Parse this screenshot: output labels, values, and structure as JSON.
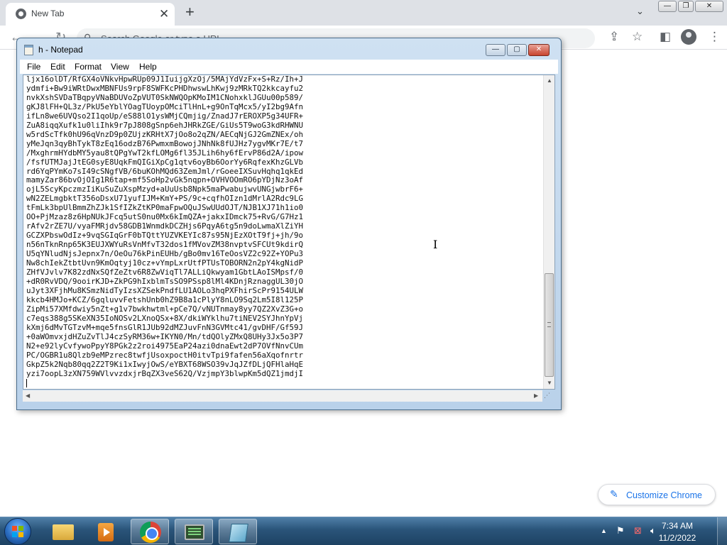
{
  "chrome": {
    "tab_title": "New Tab",
    "tab_close": "✕",
    "new_tab": "+",
    "tabs_dropdown": "⌄",
    "omnibox_placeholder": "Search Google or type a URL",
    "customize_label": "Customize Chrome",
    "window_controls": {
      "minimize": "—",
      "maximize": "❐",
      "close": "✕"
    }
  },
  "notepad": {
    "title": "h - Notepad",
    "window_controls": {
      "minimize": "—",
      "maximize": "▢",
      "close": "✕"
    },
    "menu": [
      "File",
      "Edit",
      "Format",
      "View",
      "Help"
    ],
    "lines": [
      "ljx16olDT/RfGX4oVNkvHpwRUp09J1IuijgXzOj/5MAjYdVzFx+S+Rz/Ih+J",
      "ydmfi+Bw9iWRtDwxMBNFUs9rpF8SWFKcPHDhwswLhKwj9zMRkTQ2kkcayfu2",
      "nvkXshSVDaTBqpyVNaBDUVoZpVUT0SkNWQOpKMoIM1CNohxklJGUu00p589/",
      "gKJ8lFH+QL3z/PkU5eYblYOagTUoypOMciTlHnL+g9OnTqMcx5/yI2bg9Afn",
      "ifLn8we6UVQso2I1qoUp/eS88lO1ysWMjCQmjig/ZnadJ7rEROXP5g34UFR+",
      "ZuA8iqqXufk1u0liIhk9r7pJ808gSnp6ehJHRkZGE/GiUs5T9woG3kdRHWNU",
      "w5rdScTfk0hU96qVnzD9p0ZUjzKRHtX7jOo8o2qZN/AECqNjGJ2GmZNEx/oh",
      "yMeJqn3qyBhTykT8zEq16odzB76PwmxmBowojJNhNk8fUJHz7ygvMKr7E/t7",
      "/MxghrmHYdbMY5yau8tQPgYwT2kfLOMg6fl35JLih6hy6fErvP86d2A/ipow",
      "/fsfUTMJajJtEG0syE8UqkFmQIGiXpCg1qtv6oyBb6OorYy6RqfexKhzGLVb",
      "rd6YqPYmKo7sI49cSNgfVB/6buKOhMQd63ZemJml/rGoeeIXSuvHqhq1qkEd",
      "mamyZar86bvOjOIg1R6tap+mf5SoHp2vGk5nqpn+OVHVOOmRO6pYDjNz3oAf",
      "ojL5ScyKpczmzIiKuSuZuXspMzyd+aUuUsb8Npk5maPwabujwvUNGjwbrF6+",
      "wN2ZELmgbktT356oDsxU71yufIJM+KmY+PS/9c+cqfhOIzn1dMrlA2Rdc9LG",
      "tFmLk3bpUlBmmZhZJk1SfIZkZtKP0maFpwOQuJSwUUdOJT/NJB1XJ71h1io0",
      "OO+PjMzaz8z6HpNUkJFcq5utS0nu0Mx6kImQZA+jakxIDmck75+RvG/G7Hz1",
      "rAfv2rZE7U/vyaFMRjdv58GDB1WnmdkDCZHjs6PqyA6tg5n9doLwmaXlZiYH",
      "GCZXPbswOdIz+9vqSGIqGrF0bTQttYUZVKEYIc87s95NjEzXOtT9fj+jh/9o",
      "n56nTknRnp65K3EUJXWYuRsVnMfvT32dos1fMVovZM38nvptvSFCUt9kdirQ",
      "U5qYNludNjsJepnx7n/OeOu76kPinEUHb/gBo0mv16TeOosVZ2c92Z+YOPu3",
      "Nw8chIekZtbtUvn9KmOqtyj10cz+vYmpLxrUtfPTUsTOBORN2n2pY4kgNidP",
      "ZHfVJvlv7K82zdNxSQfZeZtv6R8ZwViqTl7ALLiQkwyam1GbtLAoISMpsf/0",
      "+dR0RvVDQ/9ooirKJD+ZkPG9hIxblmTsSO9PSsp8lMl4KDnjRznaggUL30jO",
      "uJyt3XFjhMu8KSmzNidTyIzsXZSekPndfLU1AOLo3hqPXFhirScPr9154ULW",
      "kkcb4HMJo+KCZ/6gqluvvFetshUnb0hZ9B8a1cPlyY8nLO9Sq2Lm5I8l125P",
      "ZipMi57XMfdwiy5nZt+g1v7bwkhwtml+pCe7Q/vNUTnmay8yy7QZ2XvZ3G+o",
      "c7eqs388g5SKeXN35IoNOSv2LXnoQSx+8X/dkiWYklhu7tiNEV2SYJhnYpVj",
      "kXmj6dMvTGTzvM+mqe5fnsGlR1JUb92dMZJuvFnN3GVMtc41/gvDHF/Gf59J",
      "+0aWOmvxjdHZuZvTlJ4czSyRM36w+IKYN0/Mn/tdQOlyZMxQ8UHy3Jx5o3P7",
      "N2+e92lyCvfywoPpyY8PGk2z2roi4975EaP24azi0dnaEwt2dP7OVfNnvCUm",
      "PC/OGBR1u8Qlzb9eMPzrec8twfjUsoxpoctH0itvTpi9fafen56aXqofnrtr",
      "GkpZ5k2Nqb80qq2Z2T9Ki1xIwyjOwS/eYBXT68WSO39vJqJZfDLjQFHlaHqE",
      "yzi7oopL3zXN759WVlvvzdxjrBqZX3veS62Q/VzjmpY3blwpKm5dQZ1jmdjI"
    ],
    "scroll_up": "▲",
    "scroll_down": "▼",
    "scroll_left": "◀",
    "scroll_right": "▶",
    "grip": "⋰"
  },
  "taskbar": {
    "time": "7:34 AM",
    "date": "11/2/2022",
    "tray_expand": "▲",
    "windows_logo_colors": [
      "#f25022",
      "#7fba00",
      "#00a4ef",
      "#ffb900"
    ]
  },
  "colors": {
    "chrome_accent": "#1a73e8",
    "notepad_close": "#c8442f",
    "taskbar": "#2a5479"
  }
}
